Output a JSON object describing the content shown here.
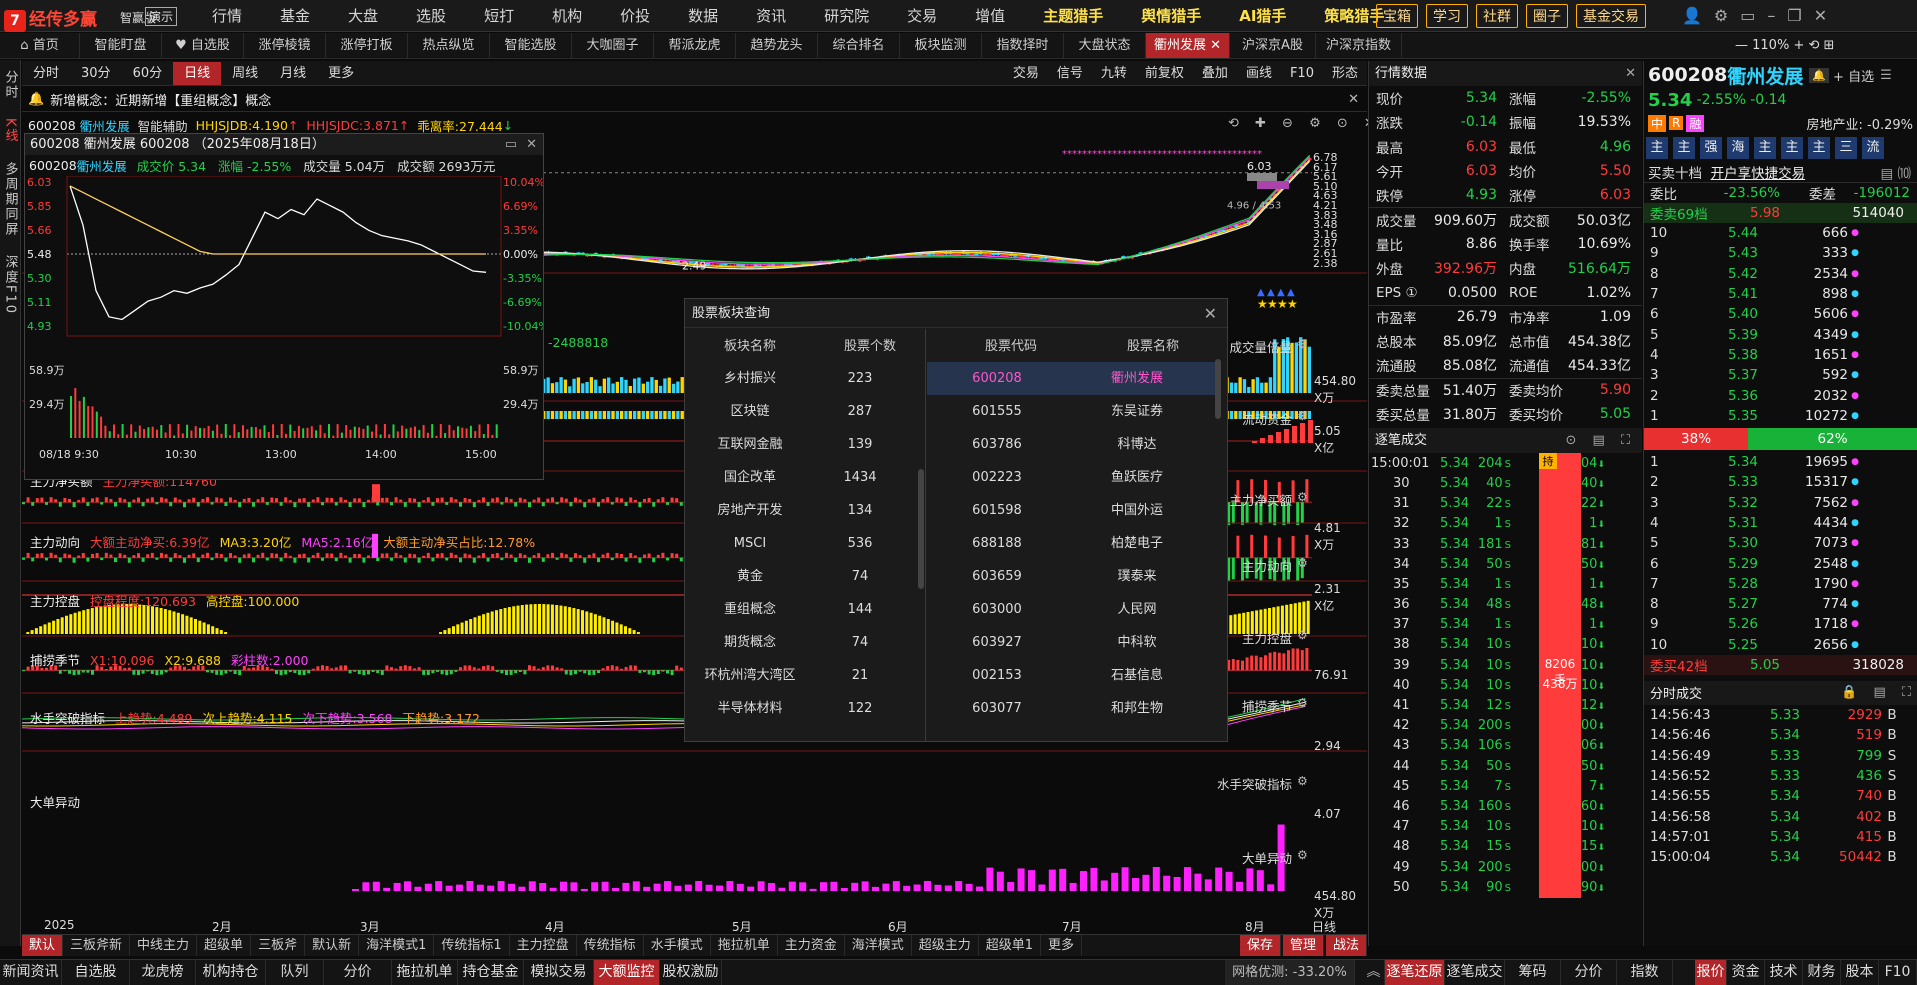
{
  "app": {
    "brand": "经传多赢",
    "edition": "智赢版",
    "demo": "演示"
  },
  "menu": [
    "行情",
    "基金",
    "大盘",
    "选股",
    "短打",
    "机构",
    "价投",
    "数据",
    "资讯",
    "研究院",
    "交易",
    "增值",
    "主题猎手",
    "舆情猎手",
    "AI猎手",
    "策略猎手"
  ],
  "menu_highlight": [
    "主题猎手",
    "舆情猎手",
    "AI猎手",
    "策略猎手"
  ],
  "tool_buttons": [
    "宝箱",
    "学习",
    "社群",
    "圈子",
    "基金交易"
  ],
  "tabs": [
    "首页",
    "智能盯盘",
    "自选股",
    "涨停棱镜",
    "涨停打板",
    "热点纵览",
    "智能选股",
    "大咖圈子",
    "帮派龙虎",
    "趋势龙头",
    "综合排名",
    "板块监测",
    "指数择时",
    "大盘状态",
    "衢州发展",
    "沪深京A股",
    "沪深京指数"
  ],
  "active_tab": "衢州发展",
  "zoom": "110%",
  "left_strip": [
    "分时",
    "K线",
    "多周期同屏",
    "深度F10"
  ],
  "chart_toolbar": {
    "periods": [
      "分时",
      "30分",
      "60分",
      "日线",
      "周线",
      "月线",
      "更多"
    ],
    "active_period": "日线",
    "right": [
      "交易",
      "信号",
      "九转",
      "前复权",
      "叠加",
      "画线",
      "F10",
      "形态"
    ]
  },
  "concept_bar": "新增概念：近期新增【重组概念】概念",
  "main_info": {
    "code": "600208",
    "name": "衢州发展",
    "assist": "智能辅助",
    "ind1": "HHJSJDB:4.190",
    "ind2": "HHJSJDC:3.871",
    "ind3": "乖离率:27.444"
  },
  "main_axis": [
    "6.78",
    "6.17",
    "5.61",
    "5.10",
    "4.63",
    "4.21",
    "3.83",
    "3.48",
    "3.16",
    "2.87",
    "2.61",
    "2.38"
  ],
  "main_marks": {
    "high": "6.03",
    "low": "2.49",
    "pair": "4.96 / 4.53"
  },
  "intraday": {
    "title": "600208 衢州发展 600208 （2025年08月18日）",
    "code": "600208",
    "name": "衢州发展",
    "price_label": "成交价 5.34",
    "change_label": "涨幅 -2.55%",
    "volume_label": "成交量 5.04万",
    "amount_label": "成交额 2693万元",
    "left_axis": [
      "6.03",
      "5.85",
      "5.66",
      "5.48",
      "5.30",
      "5.11",
      "4.93"
    ],
    "right_axis": [
      "10.04%",
      "6.69%",
      "3.35%",
      "0.00%",
      "-3.35%",
      "-6.69%",
      "-10.04%"
    ],
    "vol_axis": [
      "58.9万",
      "29.4万"
    ],
    "time_axis": [
      "08/18 9:30",
      "10:30",
      "13:00",
      "14:00",
      "15:00"
    ]
  },
  "panels": [
    {
      "key": "vol",
      "left": "",
      "label": "成交量倍量",
      "val": "454.80",
      "unit": "X万",
      "extra": "-2488818"
    },
    {
      "key": "fund",
      "left": "",
      "label": "流动资金",
      "val": "5.05",
      "unit": "X亿"
    },
    {
      "key": "net",
      "left": "主力净买额",
      "left_val": "主力净买额:114760",
      "label": "主力净买额",
      "val": "4.81",
      "unit": "X万"
    },
    {
      "key": "move",
      "left": "主力动向",
      "items": [
        "大额主动净买:6.39亿",
        "MA3:3.20亿",
        "MA5:2.16亿",
        "大额主动净买占比:12.78%"
      ],
      "label": "主力动向",
      "val": "2.31",
      "unit": "X亿"
    },
    {
      "key": "ctrl",
      "left": "主力控盘",
      "items": [
        "控盘程度:120.693",
        "高控盘:100.000"
      ],
      "label": "主力控盘",
      "val": "76.91",
      "unit": ""
    },
    {
      "key": "season",
      "left": "捕捞季节",
      "items": [
        "X1:10.096",
        "X2:9.688",
        "彩柱数:2.000"
      ],
      "label": "捕捞季节",
      "val": "2.94",
      "unit": ""
    },
    {
      "key": "water",
      "left": "水手突破指标",
      "items": [
        "上趋势:4.489",
        "次上趋势:4.115",
        "次下趋势:3.568",
        "下趋势:3.172"
      ],
      "label": "水手突破指标",
      "val": "4.07",
      "unit": ""
    },
    {
      "key": "big",
      "left": "大单异动",
      "label": "大单异动",
      "val": "454.80",
      "unit": "X万"
    }
  ],
  "date_axis": [
    "2025",
    "2月",
    "3月",
    "4月",
    "5月",
    "6月",
    "7月",
    "8月",
    "日线"
  ],
  "indicator_tabs": [
    "默认",
    "三板斧新",
    "中线主力",
    "超级单",
    "三板斧",
    "默认新",
    "海洋模式1",
    "传统指标1",
    "主力控盘",
    "传统指标",
    "水手模式",
    "拖拉机单",
    "主力资金",
    "海洋模式",
    "超级主力",
    "超级单1",
    "更多"
  ],
  "indicator_tabs_right": [
    "保存",
    "管理",
    "战法"
  ],
  "board_modal": {
    "title": "股票板块查询",
    "left_headers": [
      "板块名称",
      "股票个数"
    ],
    "right_headers": [
      "股票代码",
      "股票名称"
    ],
    "boards": [
      [
        "乡村振兴",
        "223"
      ],
      [
        "区块链",
        "287"
      ],
      [
        "互联网金融",
        "139"
      ],
      [
        "国企改革",
        "1434"
      ],
      [
        "房地产开发",
        "134"
      ],
      [
        "MSCI",
        "536"
      ],
      [
        "黄金",
        "74"
      ],
      [
        "重组概念",
        "144"
      ],
      [
        "期货概念",
        "74"
      ],
      [
        "环杭州湾大湾区",
        "21"
      ],
      [
        "半导体材料",
        "122"
      ]
    ],
    "stocks": [
      [
        "600208",
        "衢州发展"
      ],
      [
        "601555",
        "东吴证券"
      ],
      [
        "603786",
        "科博达"
      ],
      [
        "002223",
        "鱼跃医疗"
      ],
      [
        "601598",
        "中国外运"
      ],
      [
        "688188",
        "柏楚电子"
      ],
      [
        "603659",
        "璞泰来"
      ],
      [
        "603000",
        "人民网"
      ],
      [
        "603927",
        "中科软"
      ],
      [
        "002153",
        "石基信息"
      ],
      [
        "603077",
        "和邦生物"
      ]
    ]
  },
  "quote": {
    "header": "行情数据",
    "rows": [
      [
        [
          "现价",
          "5.34",
          "grn"
        ],
        [
          "涨幅",
          "-2.55%",
          "grn"
        ]
      ],
      [
        [
          "涨跌",
          "-0.14",
          "grn"
        ],
        [
          "振幅",
          "19.53%",
          "wht"
        ]
      ],
      [
        [
          "最高",
          "6.03",
          "red"
        ],
        [
          "最低",
          "4.96",
          "grn"
        ]
      ],
      [
        [
          "今开",
          "6.03",
          "red"
        ],
        [
          "均价",
          "5.50",
          "red"
        ]
      ],
      [
        [
          "跌停",
          "4.93",
          "grn"
        ],
        [
          "涨停",
          "6.03",
          "red"
        ]
      ],
      [
        [
          "成交量",
          "909.60万",
          "wht"
        ],
        [
          "成交额",
          "50.03亿",
          "wht"
        ]
      ],
      [
        [
          "量比",
          "8.86",
          "wht"
        ],
        [
          "换手率",
          "10.69%",
          "wht"
        ]
      ],
      [
        [
          "外盘",
          "392.96万",
          "red"
        ],
        [
          "内盘",
          "516.64万",
          "grn"
        ]
      ],
      [
        [
          "EPS ①",
          "0.0500",
          "wht"
        ],
        [
          "ROE",
          "1.02%",
          "wht"
        ]
      ],
      [
        [
          "市盈率",
          "26.79",
          "wht"
        ],
        [
          "市净率",
          "1.09",
          "wht"
        ]
      ],
      [
        [
          "总股本",
          "85.09亿",
          "wht"
        ],
        [
          "总市值",
          "454.38亿",
          "wht"
        ]
      ],
      [
        [
          "流通股",
          "85.08亿",
          "wht"
        ],
        [
          "流通值",
          "454.33亿",
          "wht"
        ]
      ],
      [
        [
          "委卖总量",
          "51.40万",
          "wht"
        ],
        [
          "委卖均价",
          "5.90",
          "red"
        ]
      ],
      [
        [
          "委买总量",
          "31.80万",
          "wht"
        ],
        [
          "委买均价",
          "5.05",
          "grn"
        ]
      ]
    ],
    "ticks_header": "逐笔成交",
    "ticks": [
      [
        "15:00:01",
        "5.34",
        "204",
        "S"
      ],
      [
        "30",
        "5.34",
        "40",
        "S"
      ],
      [
        "31",
        "5.34",
        "22",
        "S"
      ],
      [
        "32",
        "5.34",
        "1",
        "S"
      ],
      [
        "33",
        "5.34",
        "181",
        "S"
      ],
      [
        "34",
        "5.34",
        "50",
        "S"
      ],
      [
        "35",
        "5.34",
        "1",
        "S"
      ],
      [
        "36",
        "5.34",
        "48",
        "S"
      ],
      [
        "37",
        "5.34",
        "1",
        "S"
      ],
      [
        "38",
        "5.34",
        "10",
        "S"
      ],
      [
        "39",
        "5.34",
        "10",
        "S"
      ],
      [
        "40",
        "5.34",
        "10",
        "S"
      ],
      [
        "41",
        "5.34",
        "12",
        "S"
      ],
      [
        "42",
        "5.34",
        "200",
        "S"
      ],
      [
        "43",
        "5.34",
        "106",
        "S"
      ],
      [
        "44",
        "5.34",
        "50",
        "S"
      ],
      [
        "45",
        "5.34",
        "7",
        "S"
      ],
      [
        "46",
        "5.34",
        "160",
        "S"
      ],
      [
        "47",
        "5.34",
        "10",
        "S"
      ],
      [
        "48",
        "5.34",
        "15",
        "S"
      ],
      [
        "49",
        "5.34",
        "200",
        "S"
      ],
      [
        "50",
        "5.34",
        "90",
        "S"
      ]
    ],
    "tick_qty": [
      "204",
      "40",
      "22",
      "1",
      "181",
      "50",
      "1",
      "48",
      "1",
      "10",
      "10",
      "10",
      "12",
      "200",
      "106",
      "50",
      "7",
      "160",
      "10",
      "15",
      "200",
      "90"
    ],
    "tick_badge": "持",
    "tick_total": "8206手",
    "tick_amount": "438万"
  },
  "book": {
    "code": "600208",
    "name": "衢州发展",
    "price": "5.34",
    "chg": "-2.55%",
    "chgv": "-0.14",
    "self_btn": "自选",
    "tags": [
      "中",
      "R",
      "融"
    ],
    "industry": "房地产业: -0.29%",
    "strip": [
      "主",
      "主",
      "强",
      "海",
      "主",
      "主",
      "主",
      "三",
      "流"
    ],
    "level_label": "买卖十档",
    "fast_trade": "开户享快捷交易",
    "wb_label": "委比",
    "wb": "-23.56%",
    "wc_label": "委差",
    "wc": "-196012",
    "sell_total_label": "委卖69档",
    "sell_total_price": "5.98",
    "sell_total_qty": "514040",
    "sells": [
      [
        "10",
        "5.44",
        "666"
      ],
      [
        "9",
        "5.43",
        "333"
      ],
      [
        "8",
        "5.42",
        "2534"
      ],
      [
        "7",
        "5.41",
        "898"
      ],
      [
        "6",
        "5.40",
        "5606"
      ],
      [
        "5",
        "5.39",
        "4349"
      ],
      [
        "4",
        "5.38",
        "1651"
      ],
      [
        "3",
        "5.37",
        "592"
      ],
      [
        "2",
        "5.36",
        "2032"
      ],
      [
        "1",
        "5.35",
        "10272"
      ]
    ],
    "ratio_sell": "38%",
    "ratio_buy": "62%",
    "buys": [
      [
        "1",
        "5.34",
        "19695"
      ],
      [
        "2",
        "5.33",
        "15317"
      ],
      [
        "3",
        "5.32",
        "7562"
      ],
      [
        "4",
        "5.31",
        "4434"
      ],
      [
        "5",
        "5.30",
        "7073"
      ],
      [
        "6",
        "5.29",
        "2548"
      ],
      [
        "7",
        "5.28",
        "1790"
      ],
      [
        "8",
        "5.27",
        "774"
      ],
      [
        "9",
        "5.26",
        "1718"
      ],
      [
        "10",
        "5.25",
        "2656"
      ]
    ],
    "buy_total_label": "委买42档",
    "buy_total_price": "5.05",
    "buy_total_qty": "318028",
    "min_header": "分时成交",
    "mins": [
      [
        "14:56:43",
        "5.33",
        "2929",
        "B"
      ],
      [
        "14:56:46",
        "5.34",
        "519",
        "B"
      ],
      [
        "14:56:49",
        "5.33",
        "799",
        "S"
      ],
      [
        "14:56:52",
        "5.33",
        "436",
        "S"
      ],
      [
        "14:56:55",
        "5.34",
        "740",
        "B"
      ],
      [
        "14:56:58",
        "5.34",
        "402",
        "B"
      ],
      [
        "14:57:01",
        "5.34",
        "415",
        "B"
      ],
      [
        "15:00:04",
        "5.34",
        "50442",
        "B"
      ]
    ]
  },
  "bottom": {
    "left": [
      "新闻资讯",
      "自选股",
      "龙虎榜",
      "机构持仓",
      "队列",
      "分价",
      "拖拉机单",
      "持仓基金",
      "模拟交易",
      "大额监控",
      "股权激励"
    ],
    "active": "大额监控",
    "network": "网格优测: -33.20%",
    "mid": [
      "逐笔还原",
      "逐笔成交",
      "筹码",
      "分价",
      "指数"
    ],
    "right": [
      "报价",
      "资金",
      "技术",
      "财务",
      "股本",
      "F10"
    ]
  },
  "colors": {
    "up": "#ff3b3b",
    "down": "#22d04a",
    "accent": "#b2262a"
  }
}
